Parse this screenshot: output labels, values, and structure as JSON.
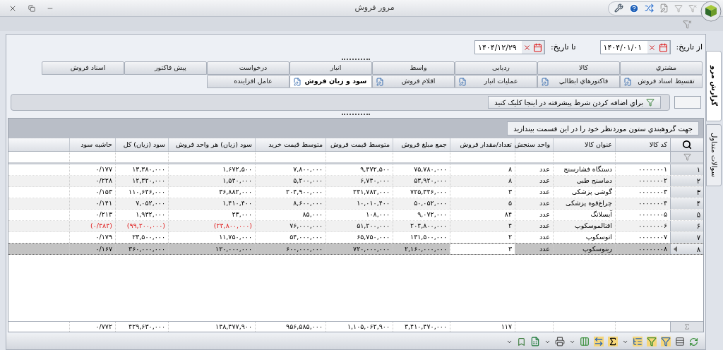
{
  "window": {
    "title": "مرور فروش"
  },
  "date_range": {
    "from_label": "از تاریخ:",
    "from_value": "۱۴۰۴/۰۱/۰۱",
    "to_label": "تا تاریخ:",
    "to_value": "۱۴۰۴/۱۲/۲۹"
  },
  "tab_rows": [
    [
      {
        "label": "مشتري",
        "selected": false,
        "has_icon": false
      },
      {
        "label": "کالا",
        "selected": false,
        "has_icon": false
      },
      {
        "label": "ردیابی",
        "selected": false,
        "has_icon": false
      },
      {
        "label": "واسط",
        "selected": false,
        "has_icon": false
      },
      {
        "label": "انبار",
        "selected": false,
        "has_icon": false
      },
      {
        "label": "درخواست",
        "selected": false,
        "has_icon": false
      },
      {
        "label": "پیش فاکتور",
        "selected": false,
        "has_icon": false
      },
      {
        "label": "اسناد فروش",
        "selected": false,
        "has_icon": false
      }
    ],
    [
      {
        "label": "تقسیط اسناد فروش",
        "selected": false,
        "has_icon": true
      },
      {
        "label": "فاکتورهاي ابطالي",
        "selected": false,
        "has_icon": true
      },
      {
        "label": "عملیات انبار",
        "selected": false,
        "has_icon": true
      },
      {
        "label": "اقلام فروش",
        "selected": false,
        "has_icon": true
      },
      {
        "label": "سود و زیان فروش",
        "selected": true,
        "has_icon": true
      },
      {
        "label": "عامل افزاینده",
        "selected": false,
        "has_icon": false
      }
    ]
  ],
  "side_tabs": [
    {
      "label": "گزارش مرو",
      "selected": true
    },
    {
      "label": "سوالات متداول",
      "selected": false
    }
  ],
  "advanced_filter": {
    "button": "براي اضافه کردن شرط پیشرفته در اینجا کلیک کنید"
  },
  "group_panel": {
    "hint": "جهت گروهبندي ستون موردنظر خود را در این قسمت بیندازید"
  },
  "table": {
    "columns": [
      "کد کالا",
      "عنوان کالا",
      "واحد سنجش",
      "تعداد/مقدار فروش",
      "جمع مبلغ فروش",
      "متوسط قیمت فروش",
      "متوسط قیمت خرید",
      "سود (زیان) هر واحد فروش",
      "سود (زیان) کل",
      "حاشیه سود"
    ],
    "rows": [
      {
        "number": "۱",
        "selected": false,
        "loss": false,
        "cells": [
          "۰۰۰۰۰۰۰۱",
          "دستگاه فشارسنج",
          "عدد",
          "۸",
          "۷۵,۷۸۰,۰۰۰",
          "۹,۴۷۲,۵۰۰",
          "۷,۸۰۰,۰۰۰",
          "۱,۶۷۲,۵۰۰",
          "۱۳,۳۸۰,۰۰۰",
          "۰/۱۷۷"
        ]
      },
      {
        "number": "۲",
        "selected": false,
        "loss": false,
        "cells": [
          "۰۰۰۰۰۰۰۲",
          "دماسنج طبي",
          "عدد",
          "۸",
          "۵۳,۹۲۰,۰۰۰",
          "۶,۷۴۰,۰۰۰",
          "۵,۲۰۰,۰۰۰",
          "۱,۵۴۰,۰۰۰",
          "۱۲,۳۲۰,۰۰۰",
          "۰/۲۲۸"
        ]
      },
      {
        "number": "۳",
        "selected": false,
        "loss": false,
        "cells": [
          "۰۰۰۰۰۰۰۳",
          "گوشی پزشکی",
          "عدد",
          "۳",
          "۷۲۵,۳۴۶,۰۰۰",
          "۲۴۱,۷۸۲,۰۰۰",
          "۲۰۴,۹۰۰,۰۰۰",
          "۳۶,۸۸۲,۰۰۰",
          "۱۱۰,۶۴۶,۰۰۰",
          "۰/۱۵۳"
        ]
      },
      {
        "number": "۴",
        "selected": false,
        "loss": false,
        "cells": [
          "۰۰۰۰۰۰۰۴",
          "چراغ‌قوه پزشکی",
          "عدد",
          "۵",
          "۵۰,۰۵۲,۰۰۰",
          "۱۰,۰۱۰,۴۰۰",
          "۸,۶۰۰,۰۰۰",
          "۱,۴۱۰,۴۰۰",
          "۷,۰۵۲,۰۰۰",
          "۰/۱۴۱"
        ]
      },
      {
        "number": "۵",
        "selected": false,
        "loss": false,
        "cells": [
          "۰۰۰۰۰۰۰۵",
          "آبسلانگ",
          "عدد",
          "۸۴",
          "۹,۰۷۲,۰۰۰",
          "۱۰۸,۰۰۰",
          "۸۵,۰۰۰",
          "۲۳,۰۰۰",
          "۱,۹۳۲,۰۰۰",
          "۰/۲۱۳"
        ]
      },
      {
        "number": "۶",
        "selected": false,
        "loss": true,
        "cells": [
          "۰۰۰۰۰۰۰۶",
          "افتالموسکوپ",
          "عدد",
          "۴",
          "۲۰۴,۸۰۰,۰۰۰",
          "۵۱,۲۰۰,۰۰۰",
          "۷۶,۰۰۰,۰۰۰",
          "(۲۴,۸۰۰,۰۰۰)",
          "(۹۹,۲۰۰,۰۰۰)",
          "(۰/۴۸۴)"
        ]
      },
      {
        "number": "۷",
        "selected": false,
        "loss": false,
        "cells": [
          "۰۰۰۰۰۰۰۷",
          "اتوسکوپ",
          "عدد",
          "۲",
          "۱۳۱,۵۰۰,۰۰۰",
          "۶۵,۷۵۰,۰۰۰",
          "۵۴,۰۰۰,۰۰۰",
          "۱۱,۷۵۰,۰۰۰",
          "۲۳,۵۰۰,۰۰۰",
          "۰/۱۷۹"
        ]
      },
      {
        "number": "۸",
        "selected": true,
        "loss": false,
        "cells": [
          "۰۰۰۰۰۰۰۸",
          "رینوسکوپ",
          "عدد",
          "۳",
          "۲,۱۶۰,۰۰۰,۰۰۰",
          "۷۲۰,۰۰۰,۰۰۰",
          "۶۰۰,۰۰۰,۰۰۰",
          "۱۲۰,۰۰۰,۰۰۰",
          "۳۶۰,۰۰۰,۰۰۰",
          "۰/۱۶۷"
        ]
      }
    ],
    "totals": [
      "۱۱۷",
      "۳,۴۱۰,۴۷۰,۰۰۰",
      "۱,۱۰۵,۰۶۲,۹۰۰",
      "۹۵۶,۵۸۵,۰۰۰",
      "۱۴۸,۴۷۷,۹۰۰",
      "۴۲۹,۶۳۰,۰۰۰",
      "۰/۷۷۲"
    ]
  }
}
